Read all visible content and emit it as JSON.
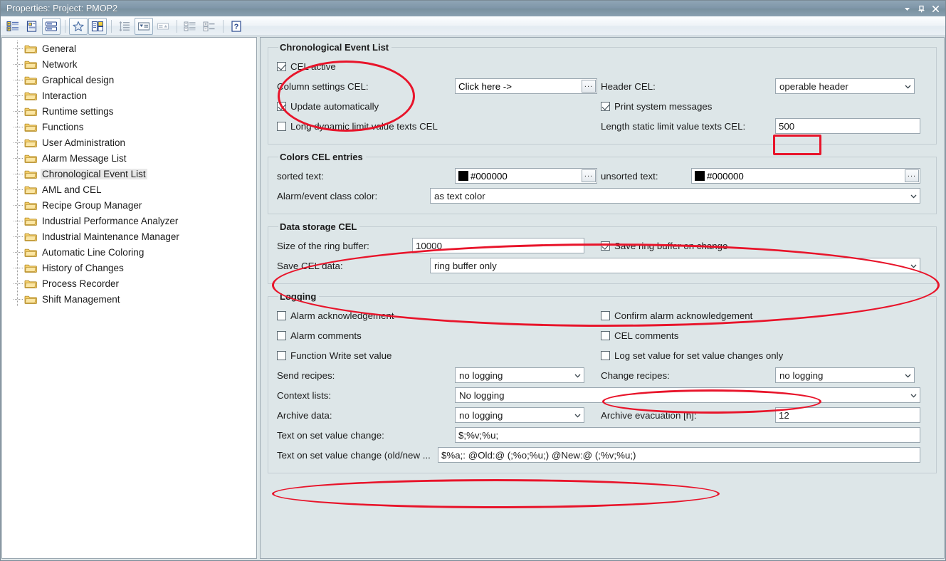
{
  "window": {
    "title": "Properties: Project: PMOP2",
    "controls": [
      {
        "name": "dropdown-menu-icon",
        "glyph": "▼"
      },
      {
        "name": "pin-icon",
        "glyph": "⊥"
      },
      {
        "name": "close-icon",
        "glyph": "✕"
      }
    ]
  },
  "toolbar": {
    "items": [
      {
        "name": "categorized-view-button",
        "label": "Categorized"
      },
      {
        "name": "property-pages-button",
        "label": "Property Pages"
      },
      {
        "name": "alphabetical-view-button",
        "label": "Alphabetical"
      },
      {
        "name": "favorites-button",
        "label": "Favorites"
      },
      {
        "name": "object-list-button",
        "label": "Object List"
      },
      {
        "name": "sort-button",
        "label": "Sort"
      },
      {
        "name": "filter-down-button",
        "label": "Filter"
      },
      {
        "name": "filter-up-button",
        "label": "Filter Up"
      },
      {
        "name": "group-button",
        "label": "Group"
      },
      {
        "name": "expand-collapse-button",
        "label": "Expand / Collapse"
      },
      {
        "name": "help-button",
        "label": "Help"
      }
    ]
  },
  "tree": {
    "selected": "Chronological Event List",
    "items": [
      {
        "label": "General"
      },
      {
        "label": "Network"
      },
      {
        "label": "Graphical design"
      },
      {
        "label": "Interaction"
      },
      {
        "label": "Runtime settings"
      },
      {
        "label": "Functions"
      },
      {
        "label": "User Administration"
      },
      {
        "label": "Alarm Message List"
      },
      {
        "label": "Chronological Event List"
      },
      {
        "label": "AML and CEL"
      },
      {
        "label": "Recipe Group Manager"
      },
      {
        "label": "Industrial Performance Analyzer"
      },
      {
        "label": "Industrial Maintenance Manager"
      },
      {
        "label": "Automatic Line Coloring"
      },
      {
        "label": "History of Changes"
      },
      {
        "label": "Process Recorder"
      },
      {
        "label": "Shift Management"
      }
    ]
  },
  "groups": {
    "cel": {
      "legend": "Chronological Event List",
      "cel_active_label": "CEL active",
      "cel_active_checked": true,
      "column_settings_label": "Column settings CEL:",
      "column_settings_value": "Click here ->",
      "column_settings_browse": "...",
      "update_auto_label": "Update automatically",
      "update_auto_checked": true,
      "long_dynamic_label": "Long dynamic limit value texts CEL",
      "long_dynamic_checked": false,
      "header_cel_label": "Header CEL:",
      "header_cel_value": "operable header",
      "print_sys_label": "Print system messages",
      "print_sys_checked": true,
      "length_static_label": "Length static limit value texts CEL:",
      "length_static_value": "500"
    },
    "colors": {
      "legend": "Colors CEL entries",
      "sorted_label": "sorted text:",
      "sorted_value": "#000000",
      "sorted_color": "#000000",
      "sorted_browse": "...",
      "unsorted_label": "unsorted text:",
      "unsorted_value": "#000000",
      "unsorted_color": "#000000",
      "unsorted_browse": "...",
      "class_color_label": "Alarm/event class color:",
      "class_color_value": "as text color"
    },
    "storage": {
      "legend": "Data storage CEL",
      "ring_size_label": "Size of the ring buffer:",
      "ring_size_value": "10000",
      "save_on_change_label": "Save ring buffer on change",
      "save_on_change_checked": true,
      "save_data_label": "Save CEL data:",
      "save_data_value": "ring buffer only"
    },
    "logging": {
      "legend": "Logging",
      "alarm_ack_label": "Alarm acknowledgement",
      "alarm_ack_checked": false,
      "confirm_ack_label": "Confirm alarm acknowledgement",
      "confirm_ack_checked": false,
      "alarm_comments_label": "Alarm comments",
      "alarm_comments_checked": false,
      "cel_comments_label": "CEL comments",
      "cel_comments_checked": false,
      "func_write_label": "Function Write set value",
      "func_write_checked": false,
      "log_setvalue_label": "Log set value for set value changes only",
      "log_setvalue_checked": false,
      "send_recipes_label": "Send recipes:",
      "send_recipes_value": "no logging",
      "change_recipes_label": "Change recipes:",
      "change_recipes_value": "no logging",
      "context_lists_label": "Context lists:",
      "context_lists_value": "No logging",
      "archive_data_label": "Archive data:",
      "archive_data_value": "no logging",
      "archive_evac_label": "Archive evacuation [h]:",
      "archive_evac_value": "12",
      "text_setvalue_label": "Text on set value change:",
      "text_setvalue_value": "$;%v;%u;",
      "text_setvalue_oldnew_label": "Text on set value change (old/new ...",
      "text_setvalue_oldnew_value": "$%a;: @Old:@ (;%o;%u;)  @New:@ (;%v;%u;)"
    }
  },
  "annotations": {
    "color": "#e8142a",
    "items": [
      {
        "name": "annotation-cel-active-group",
        "shape": "ellipse"
      },
      {
        "name": "annotation-length-static-value",
        "shape": "rect"
      },
      {
        "name": "annotation-data-storage-group",
        "shape": "ellipse"
      },
      {
        "name": "annotation-log-setvalue-checkbox",
        "shape": "ellipse"
      },
      {
        "name": "annotation-text-setvalue-row",
        "shape": "ellipse"
      }
    ]
  }
}
